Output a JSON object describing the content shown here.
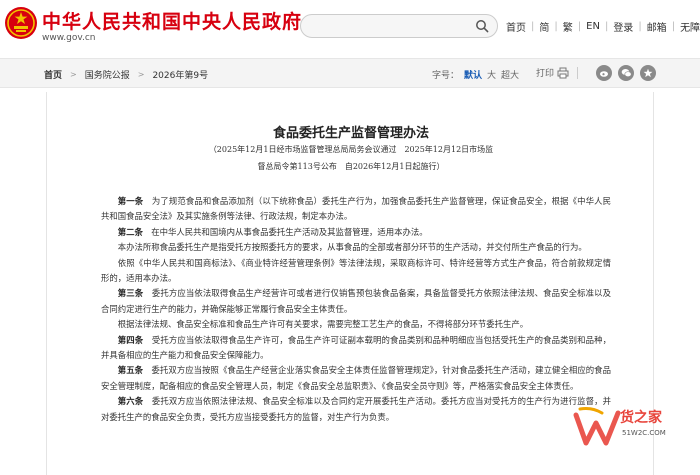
{
  "header": {
    "site_name": "中华人民共和国中央人民政府",
    "site_url": "www.gov.cn",
    "search_placeholder": "",
    "nav": [
      "首页",
      "简",
      "繁",
      "EN",
      "登录",
      "邮箱",
      "无障碍"
    ]
  },
  "breadcrumb": {
    "items": [
      "首页",
      "国务院公报",
      "2026年第9号"
    ]
  },
  "font_size": {
    "label": "字号：",
    "options": [
      "默认",
      "大",
      "超大"
    ],
    "active": "默认"
  },
  "tools": {
    "print": "打印"
  },
  "share_icons": [
    "weibo-icon",
    "wechat-icon",
    "star-icon"
  ],
  "article": {
    "title": "食品委托生产监督管理办法",
    "subtitle_line1": "（2025年12月1日经市场监督管理总局局务会议通过　2025年12月12日市场监",
    "subtitle_line2": "督总局令第113号公布　自2026年12月1日起施行）",
    "paragraphs": [
      {
        "no": "第一条",
        "text": "　为了规范食品和食品添加剂（以下统称食品）委托生产行为，加强食品委托生产监督管理，保证食品安全，根据《中华人民共和国食品安全法》及其实施条例等法律、行政法规，制定本办法。"
      },
      {
        "no": "第二条",
        "text": "　在中华人民共和国境内从事食品委托生产活动及其监督管理，适用本办法。"
      },
      {
        "no": "",
        "text": "本办法所称食品委托生产是指受托方按照委托方的要求，从事食品的全部或者部分环节的生产活动，并交付所生产食品的行为。"
      },
      {
        "no": "",
        "text": "依照《中华人民共和国商标法》、《商业特许经营管理条例》等法律法规，采取商标许可、特许经营等方式生产食品，符合前款规定情形的，适用本办法。"
      },
      {
        "no": "第三条",
        "text": "　委托方应当依法取得食品生产经营许可或者进行仅销售预包装食品备案，具备监督受托方依照法律法规、食品安全标准以及合同约定进行生产的能力，并确保能够正常履行食品安全主体责任。"
      },
      {
        "no": "",
        "text": "根据法律法规、食品安全标准和食品生产许可有关要求，需要完整工艺生产的食品，不得将部分环节委托生产。"
      },
      {
        "no": "第四条",
        "text": "　受托方应当依法取得食品生产许可，食品生产许可证副本载明的食品类别和品种明细应当包括受托生产的食品类别和品种，并具备相应的生产能力和食品安全保障能力。"
      },
      {
        "no": "第五条",
        "text": "　委托双方应当按照《食品生产经营企业落实食品安全主体责任监督管理规定》，针对食品委托生产活动，建立健全相应的食品安全管理制度，配备相应的食品安全管理人员，制定《食品安全总监职责》、《食品安全员守则》等，严格落实食品安全主体责任。"
      },
      {
        "no": "第六条",
        "text": "　委托双方应当依照法律法规、食品安全标准以及合同约定开展委托生产活动。委托方应当对受托方的生产行为进行监督，并对委托生产的食品安全负责，受托方应当接受委托方的监督，对生产行为负责。"
      }
    ]
  },
  "watermark": {
    "text": "货之家",
    "url": "51W2C.COM"
  },
  "colors": {
    "brand_red": "#d7000f",
    "link_blue": "#1a5db5"
  }
}
